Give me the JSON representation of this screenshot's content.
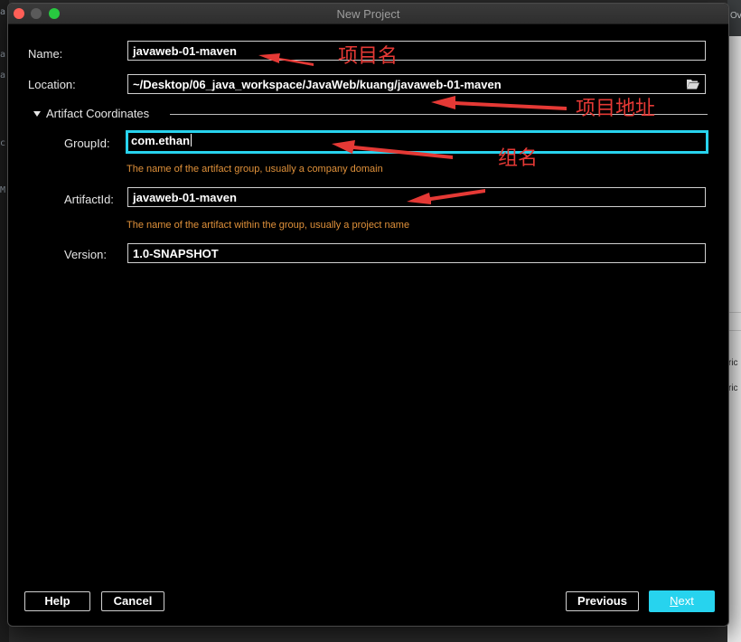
{
  "background": {
    "left_fragments": [
      "a",
      "a",
      "a",
      "c:",
      "M"
    ],
    "right_fragments": [
      "Ov",
      "ric",
      "ric"
    ]
  },
  "window": {
    "title": "New Project"
  },
  "form": {
    "name_label": "Name:",
    "name_value": "javaweb-01-maven",
    "location_label": "Location:",
    "location_value": "~/Desktop/06_java_workspace/JavaWeb/kuang/javaweb-01-maven",
    "section_label": "Artifact Coordinates",
    "groupid_label": "GroupId:",
    "groupid_value": "com.ethan",
    "groupid_hint": "The name of the artifact group, usually a company domain",
    "artifactid_label": "ArtifactId:",
    "artifactid_value": "javaweb-01-maven",
    "artifactid_hint": "The name of the artifact within the group, usually a project name",
    "version_label": "Version:",
    "version_value": "1.0-SNAPSHOT"
  },
  "annotations": {
    "name": "项目名",
    "location": "项目地址",
    "groupid": "组名"
  },
  "buttons": {
    "help": "Help",
    "cancel": "Cancel",
    "previous": "Previous",
    "next_first": "N",
    "next_rest": "ext"
  },
  "icons": {
    "folder": "folder-open-icon",
    "expand": "triangle-down-icon"
  },
  "colors": {
    "accent": "#28d3ee",
    "hint": "#e0913a",
    "annotation": "#e53935"
  }
}
